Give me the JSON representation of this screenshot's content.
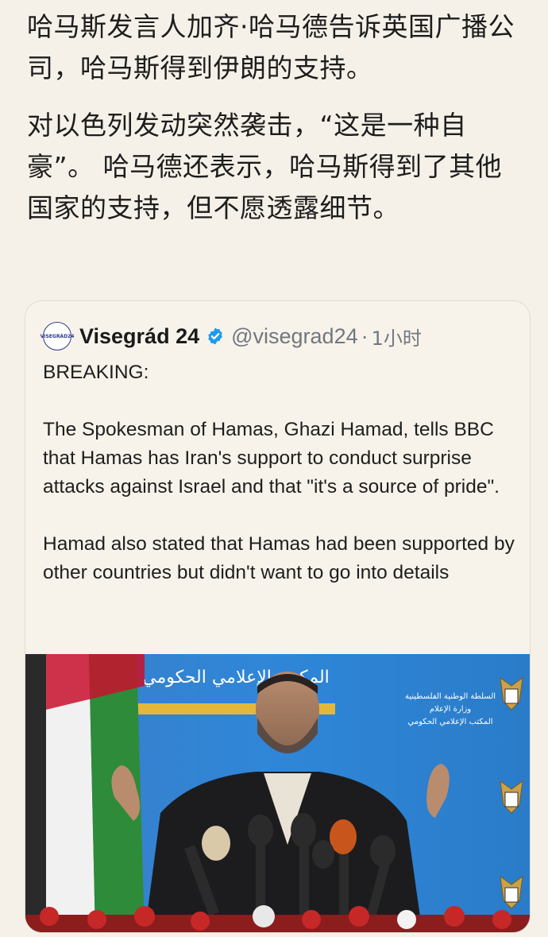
{
  "post": {
    "paragraph1": "哈马斯发言人加齐·哈马德告诉英国广播公司，哈马斯得到伊朗的支持。",
    "paragraph2": "对以色列发动突然袭击，“这是一种自豪”。 哈马德还表示，哈马斯得到了其他国家的支持，但不愿透露细节。"
  },
  "quoted_tweet": {
    "avatar_text": "VISEGRÁD24",
    "display_name": "Visegrád 24",
    "handle": "@visegrad24",
    "separator": "·",
    "time": "1小时",
    "paragraphs": [
      "BREAKING:",
      "The Spokesman of Hamas, Ghazi Hamad, tells BBC that Hamas has Iran's support to conduct surprise attacks against Israel and that \"it's a source of pride\".",
      "Hamad also stated that Hamas had been supported by other countries but didn't want to go into details"
    ],
    "photo": {
      "banner_text_top": "المكتب الإعلامي الحكومي",
      "side_text_1": "السلطة الوطنية الفلسطينية",
      "side_text_2": "وزارة الإعلام",
      "side_text_3": "المكتب الإعلامي الحكومي"
    }
  },
  "colors": {
    "page_background": "#f6f1e8",
    "verified_blue": "#1d9bf0",
    "handle_gray": "#707780",
    "backdrop_blue": "#2f7fd0"
  }
}
